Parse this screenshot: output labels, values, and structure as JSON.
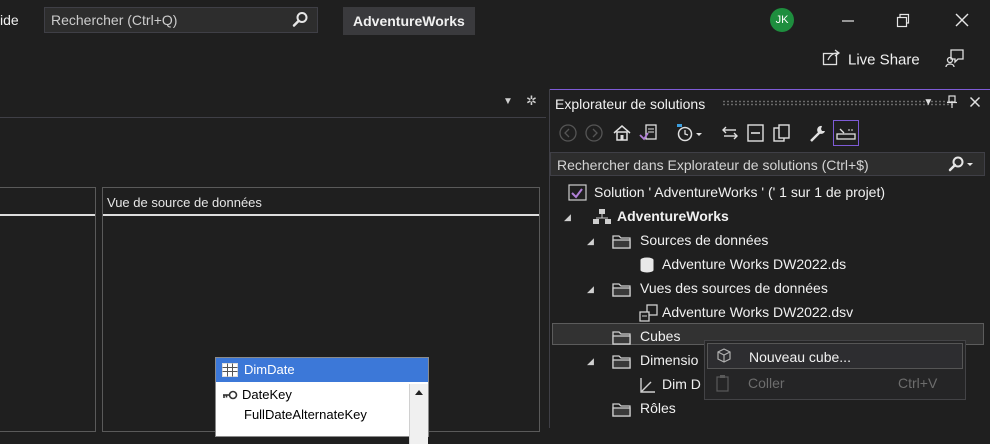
{
  "titlebar": {
    "menu_partial": "ide",
    "search_placeholder": "Rechercher (Ctrl+Q)",
    "project_name": "AdventureWorks",
    "avatar_initials": "JK",
    "avatar_color": "#1e8e3e"
  },
  "toolbar2": {
    "live_share_label": "Live Share"
  },
  "designer": {
    "dsv_pane_title": "Vue de source de données",
    "table": {
      "name": "DimDate",
      "columns": [
        "DateKey",
        "FullDateAlternateKey"
      ]
    }
  },
  "solution_explorer": {
    "title": "Explorateur de solutions",
    "search_placeholder": "Rechercher dans Explorateur de solutions (Ctrl+$)",
    "tree": [
      {
        "label": "Solution ' AdventureWorks ' (' 1 sur 1 de projet)"
      },
      {
        "label": "AdventureWorks"
      },
      {
        "label": "Sources de données"
      },
      {
        "label": "Adventure Works DW2022.ds"
      },
      {
        "label": "Vues des sources de données"
      },
      {
        "label": "Adventure Works DW2022.dsv"
      },
      {
        "label": "Cubes"
      },
      {
        "label": "Dimensio"
      },
      {
        "label": "Dim D"
      },
      {
        "label": "Rôles"
      }
    ]
  },
  "context_menu": {
    "items": [
      {
        "label": "Nouveau cube...",
        "shortcut": "",
        "enabled": true
      },
      {
        "label": "Coller",
        "shortcut": "Ctrl+V",
        "enabled": false
      }
    ]
  },
  "colors": {
    "accent": "#7e5bd6",
    "table_header": "#3c78d8",
    "background": "#1f1f1f"
  }
}
